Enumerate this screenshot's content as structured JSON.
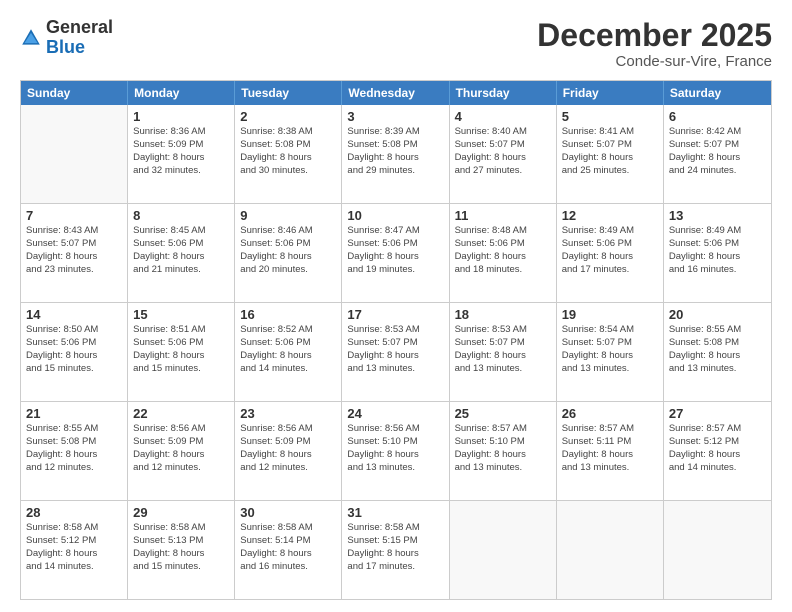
{
  "logo": {
    "general": "General",
    "blue": "Blue"
  },
  "title": "December 2025",
  "subtitle": "Conde-sur-Vire, France",
  "header_days": [
    "Sunday",
    "Monday",
    "Tuesday",
    "Wednesday",
    "Thursday",
    "Friday",
    "Saturday"
  ],
  "weeks": [
    [
      {
        "day": "",
        "lines": []
      },
      {
        "day": "1",
        "lines": [
          "Sunrise: 8:36 AM",
          "Sunset: 5:09 PM",
          "Daylight: 8 hours",
          "and 32 minutes."
        ]
      },
      {
        "day": "2",
        "lines": [
          "Sunrise: 8:38 AM",
          "Sunset: 5:08 PM",
          "Daylight: 8 hours",
          "and 30 minutes."
        ]
      },
      {
        "day": "3",
        "lines": [
          "Sunrise: 8:39 AM",
          "Sunset: 5:08 PM",
          "Daylight: 8 hours",
          "and 29 minutes."
        ]
      },
      {
        "day": "4",
        "lines": [
          "Sunrise: 8:40 AM",
          "Sunset: 5:07 PM",
          "Daylight: 8 hours",
          "and 27 minutes."
        ]
      },
      {
        "day": "5",
        "lines": [
          "Sunrise: 8:41 AM",
          "Sunset: 5:07 PM",
          "Daylight: 8 hours",
          "and 25 minutes."
        ]
      },
      {
        "day": "6",
        "lines": [
          "Sunrise: 8:42 AM",
          "Sunset: 5:07 PM",
          "Daylight: 8 hours",
          "and 24 minutes."
        ]
      }
    ],
    [
      {
        "day": "7",
        "lines": [
          "Sunrise: 8:43 AM",
          "Sunset: 5:07 PM",
          "Daylight: 8 hours",
          "and 23 minutes."
        ]
      },
      {
        "day": "8",
        "lines": [
          "Sunrise: 8:45 AM",
          "Sunset: 5:06 PM",
          "Daylight: 8 hours",
          "and 21 minutes."
        ]
      },
      {
        "day": "9",
        "lines": [
          "Sunrise: 8:46 AM",
          "Sunset: 5:06 PM",
          "Daylight: 8 hours",
          "and 20 minutes."
        ]
      },
      {
        "day": "10",
        "lines": [
          "Sunrise: 8:47 AM",
          "Sunset: 5:06 PM",
          "Daylight: 8 hours",
          "and 19 minutes."
        ]
      },
      {
        "day": "11",
        "lines": [
          "Sunrise: 8:48 AM",
          "Sunset: 5:06 PM",
          "Daylight: 8 hours",
          "and 18 minutes."
        ]
      },
      {
        "day": "12",
        "lines": [
          "Sunrise: 8:49 AM",
          "Sunset: 5:06 PM",
          "Daylight: 8 hours",
          "and 17 minutes."
        ]
      },
      {
        "day": "13",
        "lines": [
          "Sunrise: 8:49 AM",
          "Sunset: 5:06 PM",
          "Daylight: 8 hours",
          "and 16 minutes."
        ]
      }
    ],
    [
      {
        "day": "14",
        "lines": [
          "Sunrise: 8:50 AM",
          "Sunset: 5:06 PM",
          "Daylight: 8 hours",
          "and 15 minutes."
        ]
      },
      {
        "day": "15",
        "lines": [
          "Sunrise: 8:51 AM",
          "Sunset: 5:06 PM",
          "Daylight: 8 hours",
          "and 15 minutes."
        ]
      },
      {
        "day": "16",
        "lines": [
          "Sunrise: 8:52 AM",
          "Sunset: 5:06 PM",
          "Daylight: 8 hours",
          "and 14 minutes."
        ]
      },
      {
        "day": "17",
        "lines": [
          "Sunrise: 8:53 AM",
          "Sunset: 5:07 PM",
          "Daylight: 8 hours",
          "and 13 minutes."
        ]
      },
      {
        "day": "18",
        "lines": [
          "Sunrise: 8:53 AM",
          "Sunset: 5:07 PM",
          "Daylight: 8 hours",
          "and 13 minutes."
        ]
      },
      {
        "day": "19",
        "lines": [
          "Sunrise: 8:54 AM",
          "Sunset: 5:07 PM",
          "Daylight: 8 hours",
          "and 13 minutes."
        ]
      },
      {
        "day": "20",
        "lines": [
          "Sunrise: 8:55 AM",
          "Sunset: 5:08 PM",
          "Daylight: 8 hours",
          "and 13 minutes."
        ]
      }
    ],
    [
      {
        "day": "21",
        "lines": [
          "Sunrise: 8:55 AM",
          "Sunset: 5:08 PM",
          "Daylight: 8 hours",
          "and 12 minutes."
        ]
      },
      {
        "day": "22",
        "lines": [
          "Sunrise: 8:56 AM",
          "Sunset: 5:09 PM",
          "Daylight: 8 hours",
          "and 12 minutes."
        ]
      },
      {
        "day": "23",
        "lines": [
          "Sunrise: 8:56 AM",
          "Sunset: 5:09 PM",
          "Daylight: 8 hours",
          "and 12 minutes."
        ]
      },
      {
        "day": "24",
        "lines": [
          "Sunrise: 8:56 AM",
          "Sunset: 5:10 PM",
          "Daylight: 8 hours",
          "and 13 minutes."
        ]
      },
      {
        "day": "25",
        "lines": [
          "Sunrise: 8:57 AM",
          "Sunset: 5:10 PM",
          "Daylight: 8 hours",
          "and 13 minutes."
        ]
      },
      {
        "day": "26",
        "lines": [
          "Sunrise: 8:57 AM",
          "Sunset: 5:11 PM",
          "Daylight: 8 hours",
          "and 13 minutes."
        ]
      },
      {
        "day": "27",
        "lines": [
          "Sunrise: 8:57 AM",
          "Sunset: 5:12 PM",
          "Daylight: 8 hours",
          "and 14 minutes."
        ]
      }
    ],
    [
      {
        "day": "28",
        "lines": [
          "Sunrise: 8:58 AM",
          "Sunset: 5:12 PM",
          "Daylight: 8 hours",
          "and 14 minutes."
        ]
      },
      {
        "day": "29",
        "lines": [
          "Sunrise: 8:58 AM",
          "Sunset: 5:13 PM",
          "Daylight: 8 hours",
          "and 15 minutes."
        ]
      },
      {
        "day": "30",
        "lines": [
          "Sunrise: 8:58 AM",
          "Sunset: 5:14 PM",
          "Daylight: 8 hours",
          "and 16 minutes."
        ]
      },
      {
        "day": "31",
        "lines": [
          "Sunrise: 8:58 AM",
          "Sunset: 5:15 PM",
          "Daylight: 8 hours",
          "and 17 minutes."
        ]
      },
      {
        "day": "",
        "lines": []
      },
      {
        "day": "",
        "lines": []
      },
      {
        "day": "",
        "lines": []
      }
    ]
  ]
}
